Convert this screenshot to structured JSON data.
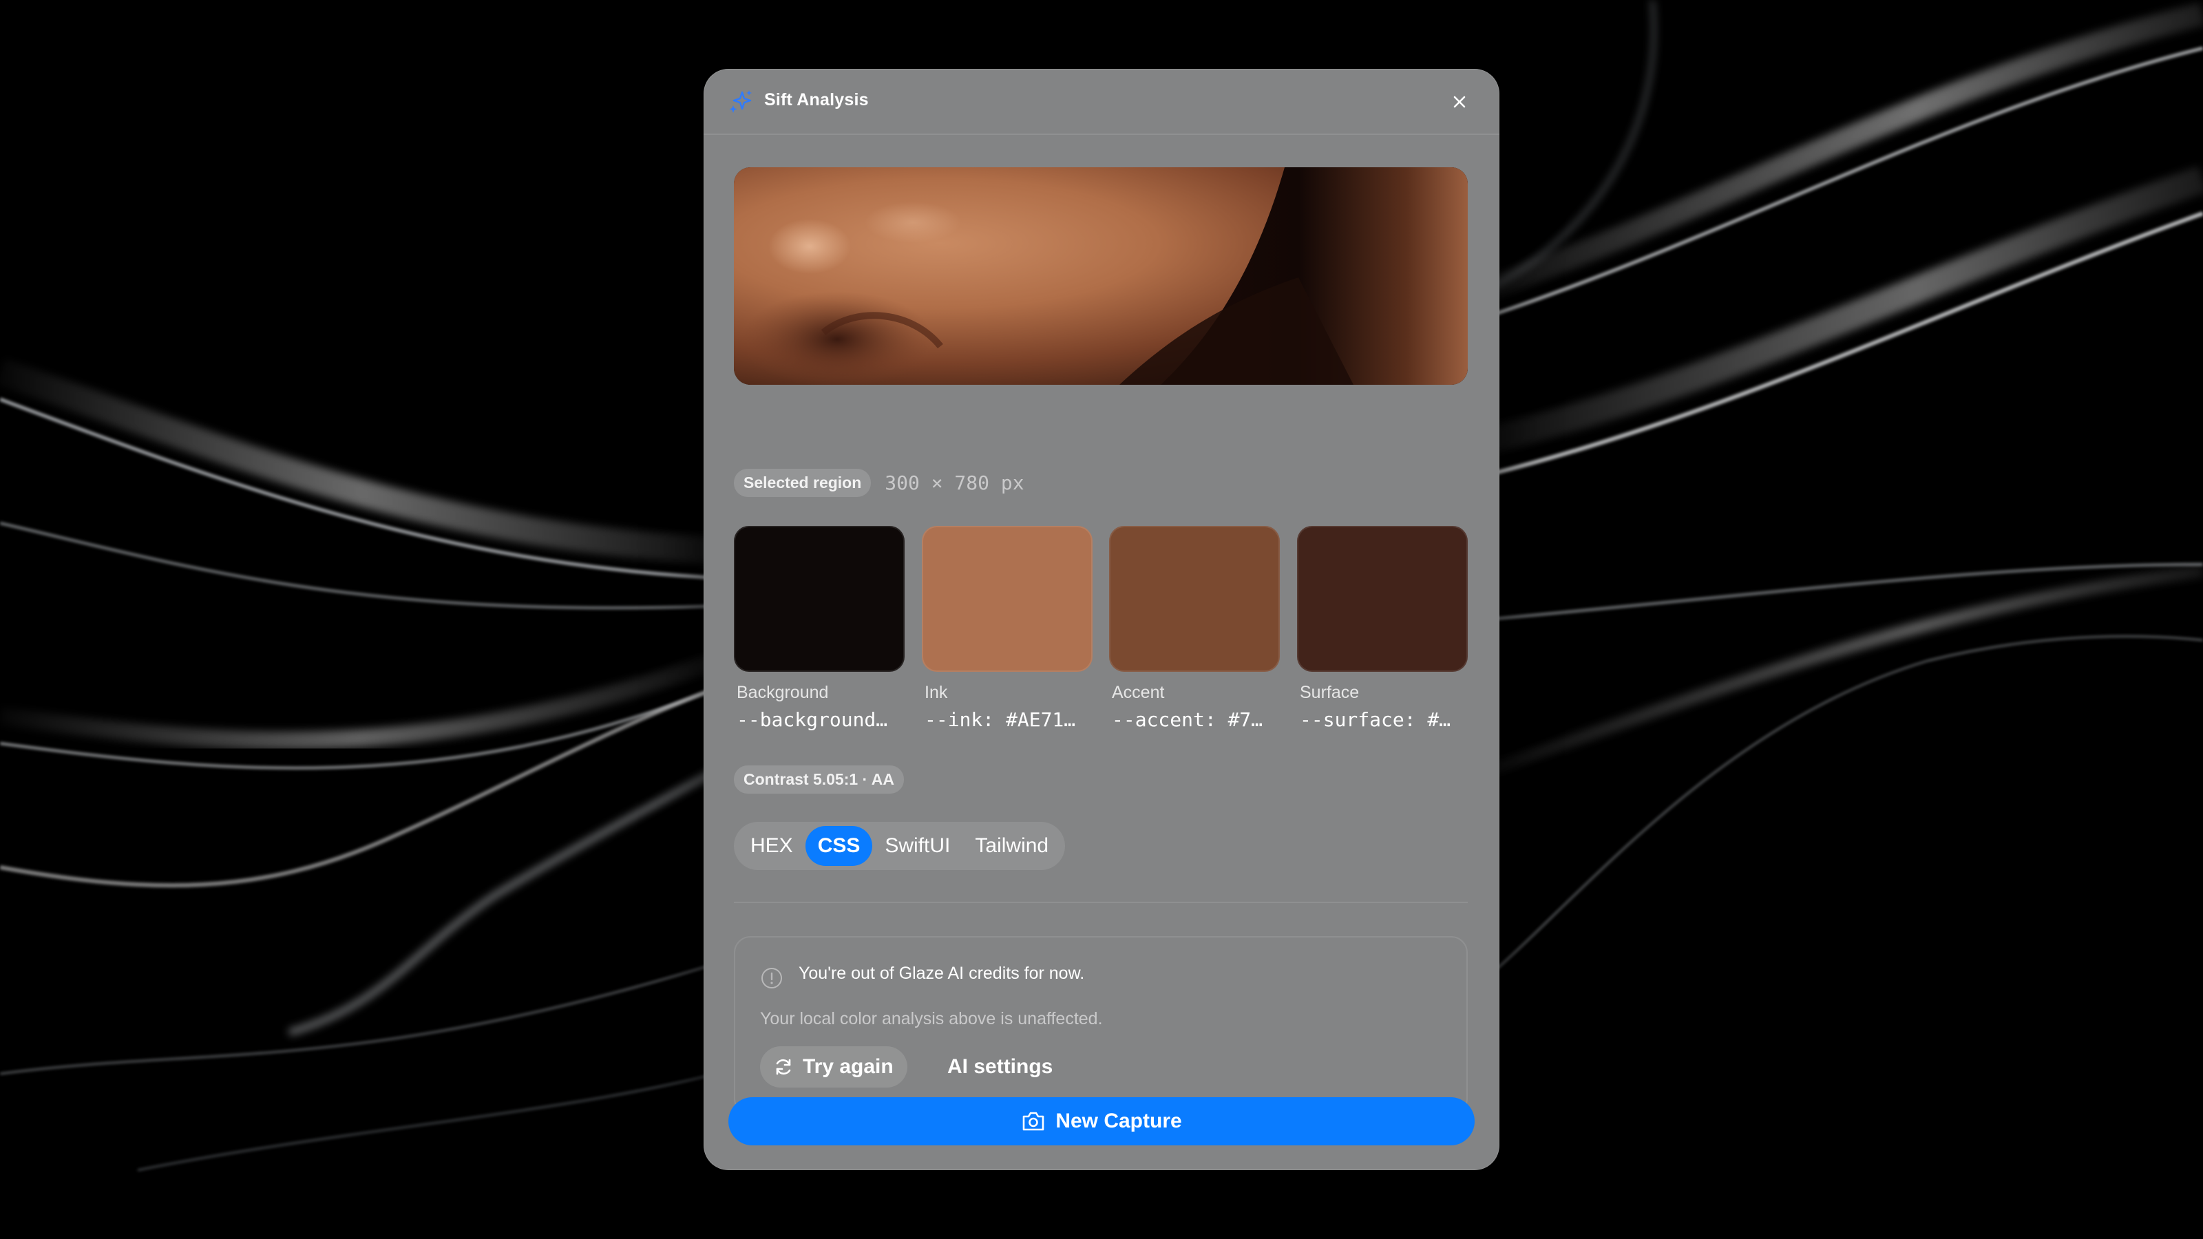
{
  "window": {
    "title": "Sift Analysis",
    "app_icon": "sparkles-icon",
    "close_icon": "close-icon"
  },
  "preview": {
    "region_label": "Selected region",
    "dimensions": "300 × 780 px"
  },
  "swatches": [
    {
      "name": "Background",
      "code": "--background…",
      "color": "#0E0908"
    },
    {
      "name": "Ink",
      "code": "--ink: #AE71…",
      "color": "#AE7150"
    },
    {
      "name": "Accent",
      "code": "--accent: #7…",
      "color": "#7B4A30"
    },
    {
      "name": "Surface",
      "code": "--surface: #…",
      "color": "#42231A"
    }
  ],
  "contrast": {
    "label": "Contrast 5.05:1 · AA"
  },
  "format_tabs": {
    "items": [
      "HEX",
      "CSS",
      "SwiftUI",
      "Tailwind"
    ],
    "selected": "CSS"
  },
  "ai_notice": {
    "icon": "info-icon",
    "message": "You're out of Glaze AI credits for now.",
    "subtext": "Your local color analysis above is unaffected.",
    "retry_label": "Try again",
    "retry_icon": "refresh-icon",
    "settings_label": "AI settings"
  },
  "capture": {
    "label": "New Capture",
    "icon": "camera-icon"
  },
  "colors": {
    "accent_blue": "#0A7CFF",
    "panel": "#838485"
  }
}
